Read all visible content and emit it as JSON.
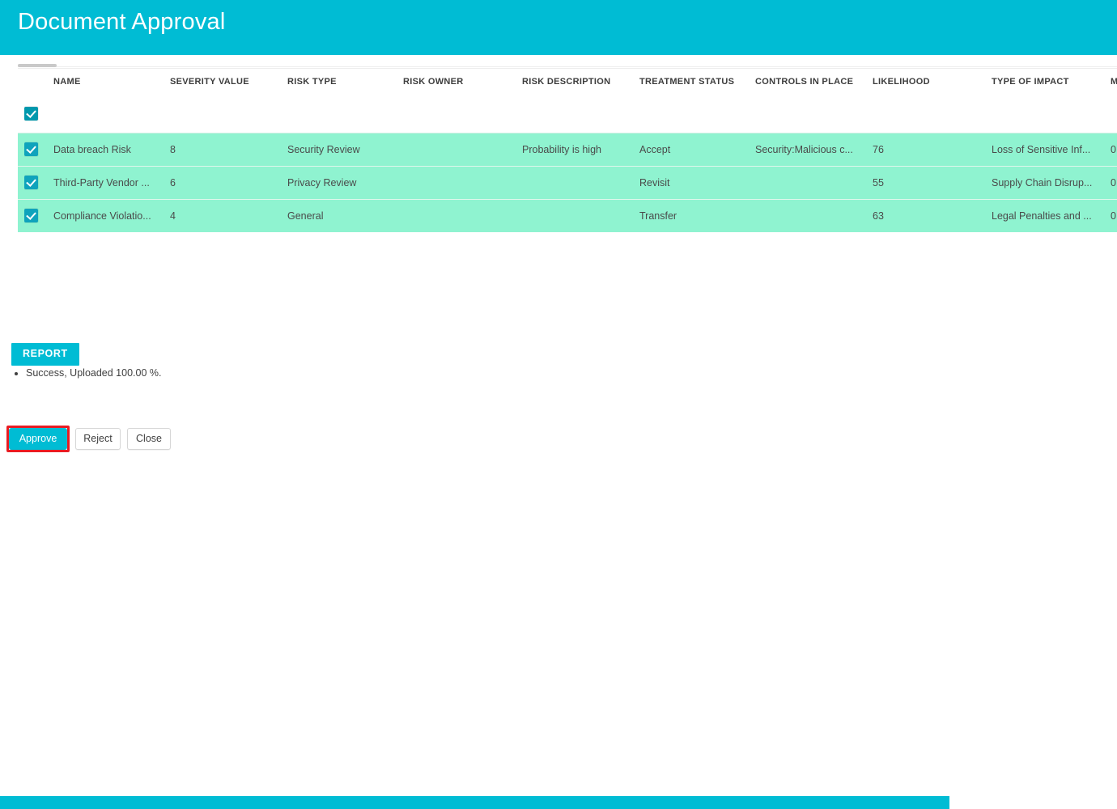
{
  "header": {
    "title": "Document Approval",
    "background_color": "#00bcd4"
  },
  "grid": {
    "selected_row_color": "#8ff3d0",
    "checkbox_color": "#0098ad",
    "columns": [
      "NAME",
      "SEVERITY VALUE",
      "RISK TYPE",
      "RISK OWNER",
      "RISK DESCRIPTION",
      "TREATMENT STATUS",
      "CONTROLS IN PLACE",
      "LIKELIHOOD",
      "TYPE OF IMPACT",
      "M"
    ],
    "rows": [
      {
        "selected": true,
        "cells": [
          "Data breach Risk",
          "8",
          "Security Review",
          "",
          "Probability is high",
          "Accept",
          "Security:Malicious c...",
          "76",
          "Loss of Sensitive Inf...",
          "0"
        ]
      },
      {
        "selected": true,
        "cells": [
          "Third-Party Vendor ...",
          "6",
          "Privacy Review",
          "",
          "",
          "Revisit",
          "",
          "55",
          "Supply Chain Disrup...",
          "0"
        ]
      },
      {
        "selected": true,
        "cells": [
          "Compliance Violatio...",
          "4",
          "General",
          "",
          "",
          "Transfer",
          "",
          "63",
          "Legal Penalties and ...",
          "0"
        ]
      }
    ]
  },
  "report": {
    "button_label": "REPORT",
    "status_messages": [
      "Success, Uploaded 100.00 %."
    ]
  },
  "progress": {
    "percent": "100.00",
    "fill_color": "#00bcd4"
  },
  "footer": {
    "approve_label": "Approve",
    "reject_label": "Reject",
    "close_label": "Close",
    "highlight_color": "#e81c23"
  }
}
